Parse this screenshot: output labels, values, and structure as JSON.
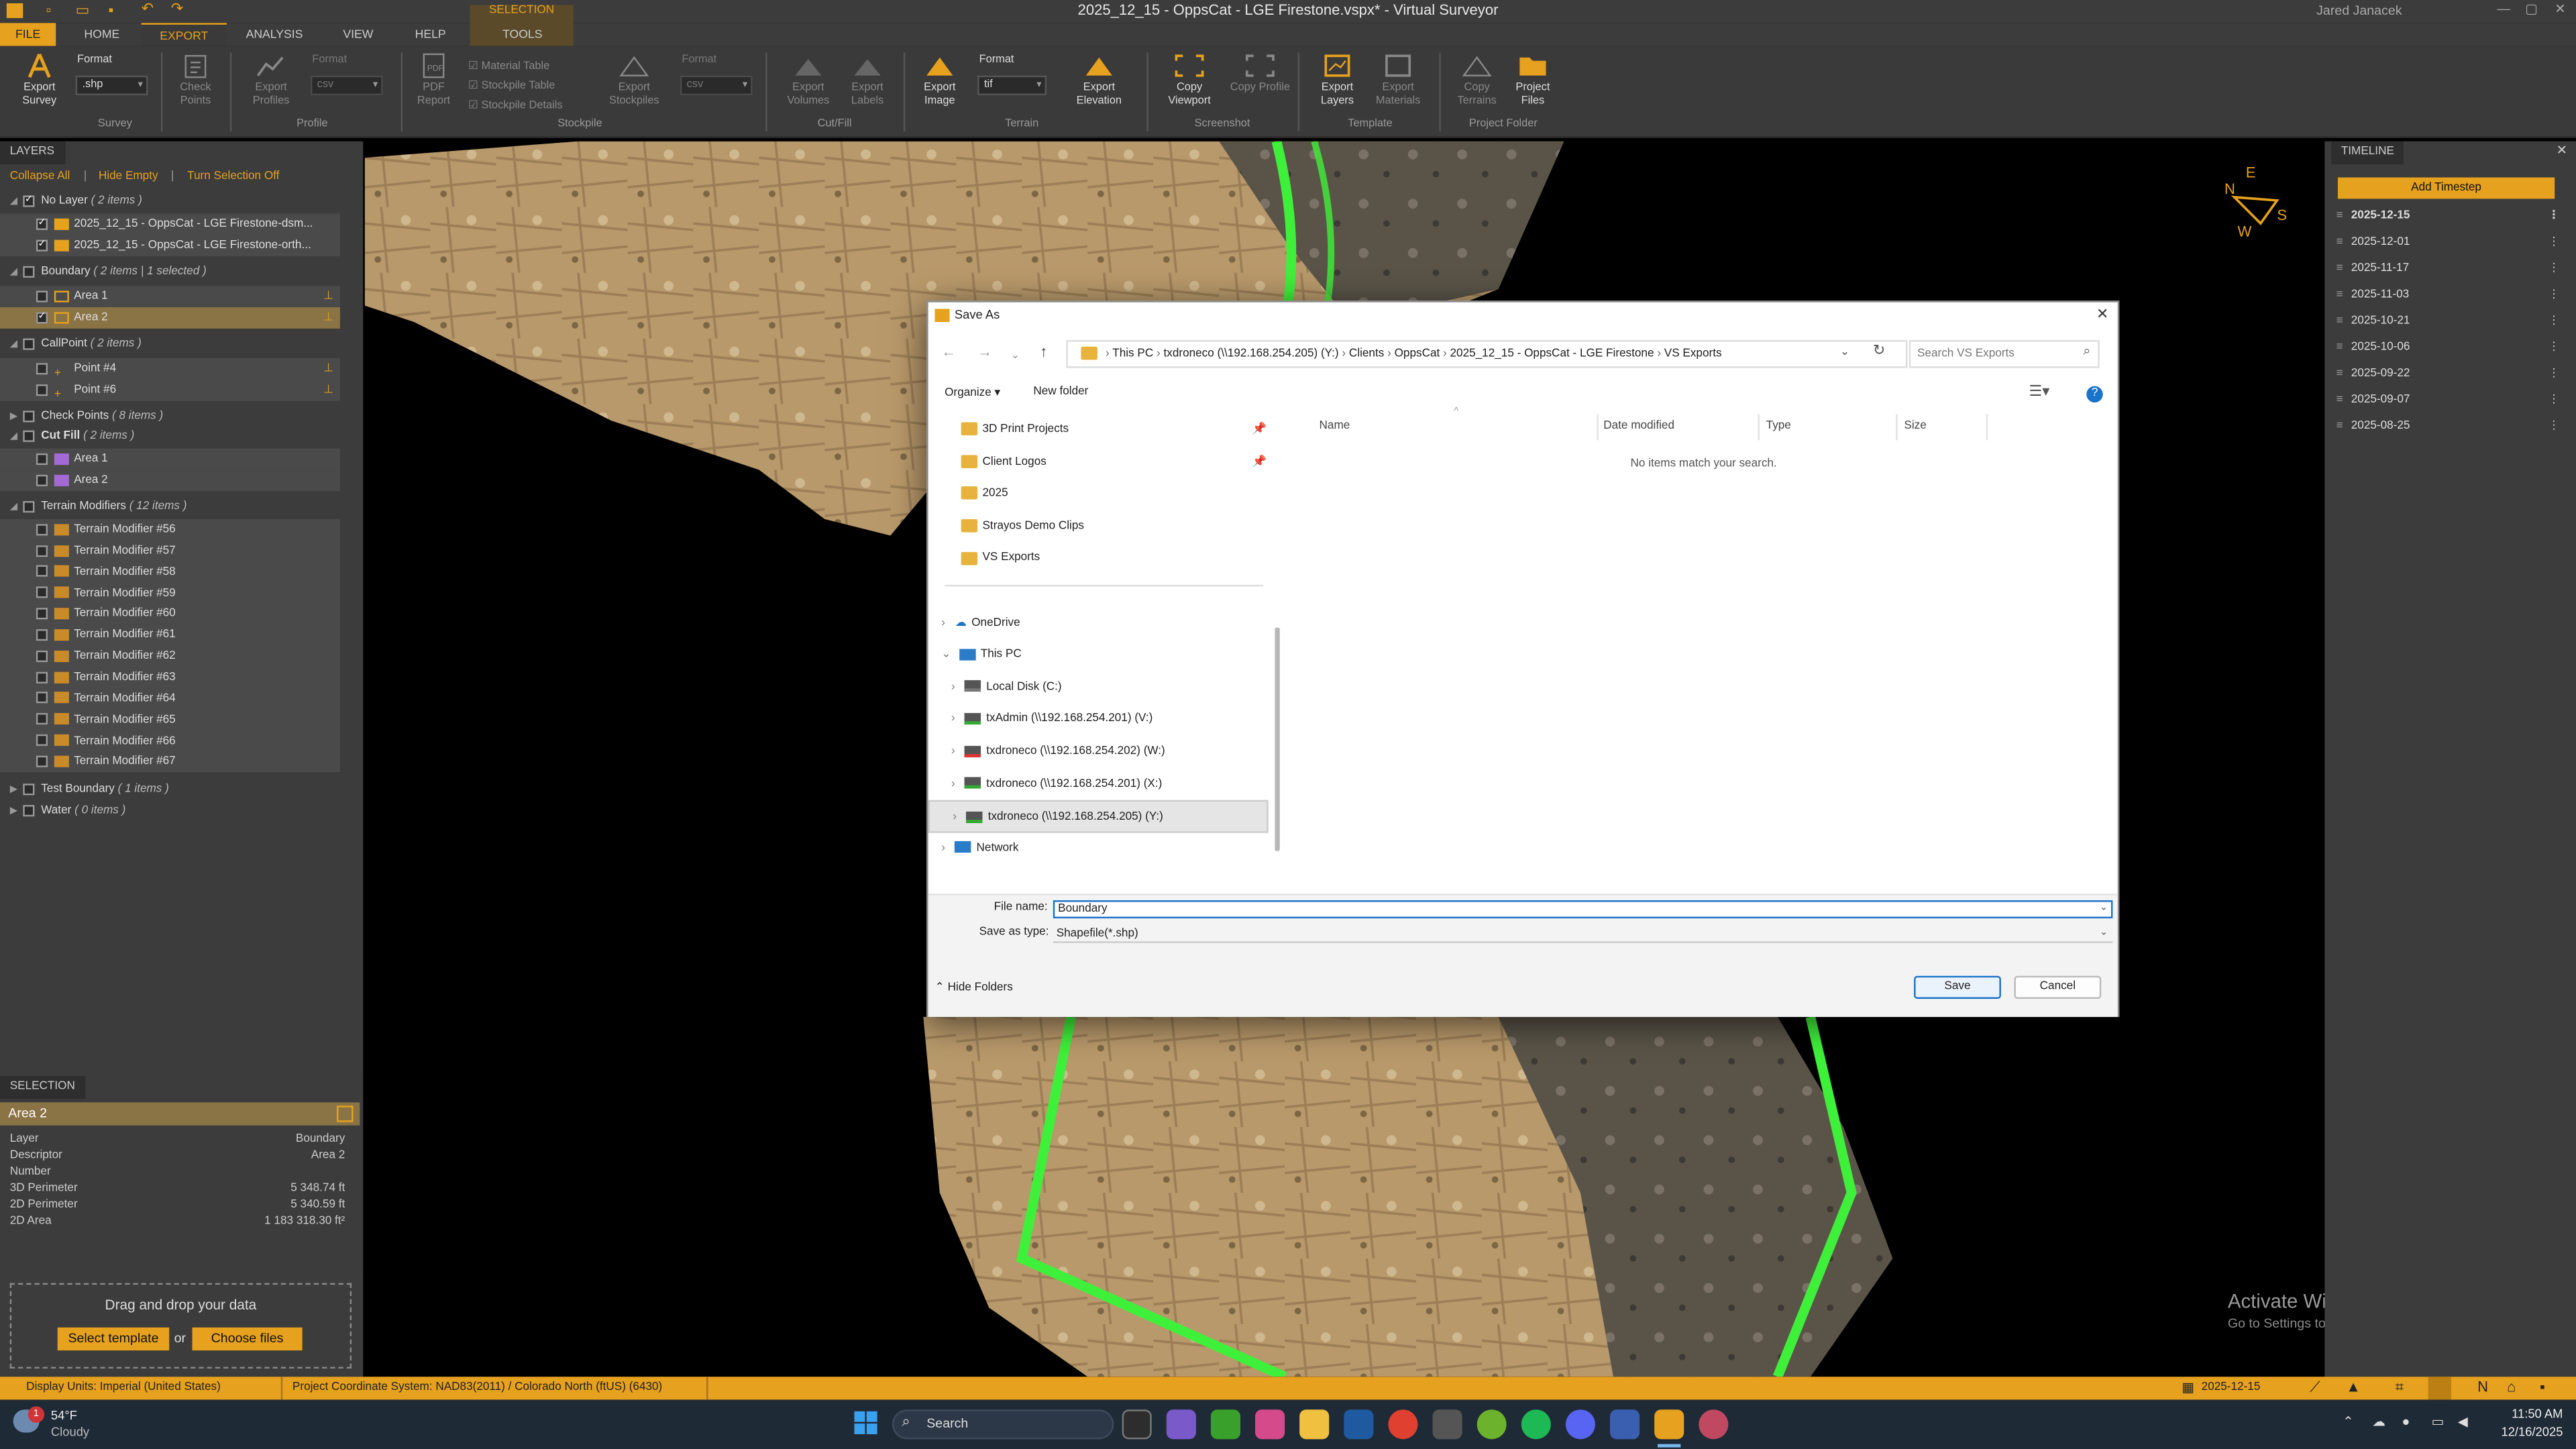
{
  "app": {
    "title": "2025_12_15 - OppsCat - LGE Firestone.vspx* - Virtual Surveyor",
    "user": "Jared Janacek",
    "selection_context": "SELECTION",
    "tabs": [
      "FILE",
      "HOME",
      "EXPORT",
      "ANALYSIS",
      "VIEW",
      "HELP",
      "TOOLS"
    ],
    "active_tab": "EXPORT",
    "accent_color": "#e6a11e"
  },
  "ribbon": {
    "survey": {
      "export_survey": "Export Survey",
      "format_label": "Format",
      "format_value": ".shp",
      "group": "Survey"
    },
    "check_points": "Check Points",
    "profile": {
      "export_profiles": "Export Profiles",
      "format_label": "Format",
      "format_value": "csv",
      "group": "Profile"
    },
    "stockpile": {
      "pdf_report": "PDF Report",
      "material_table": "Material Table",
      "stockpile_table": "Stockpile Table",
      "stockpile_details": "Stockpile Details",
      "export_stockpiles": "Export Stockpiles",
      "format_label": "Format",
      "format_value": "csv",
      "group": "Stockpile"
    },
    "cutfill": {
      "export_volumes": "Export Volumes",
      "export_labels": "Export Labels",
      "group": "Cut/Fill"
    },
    "terrain": {
      "export_image": "Export Image",
      "format_label": "Format",
      "format_value": "tif",
      "export_elevation": "Export Elevation",
      "group": "Terrain"
    },
    "screenshot": {
      "copy_viewport": "Copy Viewport",
      "copy_profile": "Copy Profile",
      "group": "Screenshot"
    },
    "template": {
      "export_layers": "Export Layers",
      "export_materials": "Export Materials",
      "group": "Template"
    },
    "project_folder": {
      "copy_terrains": "Copy Terrains",
      "project_files": "Project Files",
      "group": "Project Folder"
    }
  },
  "layers": {
    "header": "LAYERS",
    "actions": [
      "Collapse All",
      "Hide Empty",
      "Turn Selection Off"
    ],
    "groups": [
      {
        "name": "No Layer",
        "count": "( 2 items )",
        "items": [
          "2025_12_15 - OppsCat - LGE Firestone-dsm...",
          "2025_12_15 - OppsCat - LGE Firestone-orth..."
        ]
      },
      {
        "name": "Boundary",
        "count": "( 2 items | 1 selected )",
        "items": [
          "Area 1",
          "Area 2"
        ]
      },
      {
        "name": "CallPoint",
        "count": "( 2 items )",
        "items": [
          "Point #4",
          "Point #6"
        ]
      },
      {
        "name": "Check Points",
        "count": "( 8 items )",
        "items": []
      },
      {
        "name": "Cut Fill",
        "count": "( 2 items )",
        "items": [
          "Area 1",
          "Area 2"
        ]
      },
      {
        "name": "Terrain Modifiers",
        "count": "( 12 items )",
        "items": [
          "Terrain Modifier #56",
          "Terrain Modifier #57",
          "Terrain Modifier #58",
          "Terrain Modifier #59",
          "Terrain Modifier #60",
          "Terrain Modifier #61",
          "Terrain Modifier #62",
          "Terrain Modifier #63",
          "Terrain Modifier #64",
          "Terrain Modifier #65",
          "Terrain Modifier #66",
          "Terrain Modifier #67"
        ]
      },
      {
        "name": "Test Boundary",
        "count": "( 1 items )",
        "items": []
      },
      {
        "name": "Water",
        "count": "( 0 items )",
        "items": []
      }
    ]
  },
  "selection": {
    "header": "SELECTION",
    "name": "Area 2",
    "rows": [
      {
        "label": "Layer",
        "value": "Boundary"
      },
      {
        "label": "Descriptor",
        "value": "Area 2"
      },
      {
        "label": "Number",
        "value": ""
      },
      {
        "label": "3D Perimeter",
        "value": "5 348.74 ft"
      },
      {
        "label": "2D Perimeter",
        "value": "5 340.59 ft"
      },
      {
        "label": "2D Area",
        "value": "1 183 318.30 ft²"
      }
    ],
    "drop_text": "Drag and drop your data",
    "select_template": "Select template",
    "or": "or",
    "choose_files": "Choose files"
  },
  "timeline": {
    "header": "TIMELINE",
    "add_button": "Add Timestep",
    "dates": [
      "2025-12-15",
      "2025-12-01",
      "2025-11-17",
      "2025-11-03",
      "2025-10-21",
      "2025-10-06",
      "2025-09-22",
      "2025-09-07",
      "2025-08-25"
    ],
    "active": "2025-12-15"
  },
  "compass": {
    "n": "N",
    "e": "E",
    "s": "S",
    "w": "W"
  },
  "watermark": {
    "line1": "Activate Windows",
    "line2": "Go to Settings to activate Windows."
  },
  "statusbar": {
    "display_units": "Display Units:  Imperial (United States)",
    "coord_system": "Project Coordinate System:  NAD83(2011) / Colorado North (ftUS) (6430)",
    "date": "2025-12-15"
  },
  "taskbar": {
    "weather_temp": "54°F",
    "weather_cond": "Cloudy",
    "weather_badge": "1",
    "search": "Search",
    "time": "11:50 AM",
    "date": "12/16/2025"
  },
  "dialog": {
    "title": "Save As",
    "breadcrumb": [
      "This PC",
      "txdroneco (\\\\192.168.254.205) (Y:)",
      "Clients",
      "OppsCat",
      "2025_12_15 - OppsCat - LGE Firestone",
      "VS Exports"
    ],
    "search_placeholder": "Search VS Exports",
    "organize": "Organize",
    "new_folder": "New folder",
    "nav_quick": [
      "3D Print Projects",
      "Client Logos",
      "2025",
      "Strayos Demo Clips",
      "VS Exports"
    ],
    "onedrive": "OneDrive",
    "this_pc": "This PC",
    "drives": [
      "Local Disk (C:)",
      "txAdmin (\\\\192.168.254.201) (V:)",
      "txdroneco (\\\\192.168.254.202) (W:)",
      "txdroneco (\\\\192.168.254.201) (X:)",
      "txdroneco (\\\\192.168.254.205) (Y:)"
    ],
    "network": "Network",
    "columns": [
      "Name",
      "Date modified",
      "Type",
      "Size"
    ],
    "empty_message": "No items match your search.",
    "file_name_label": "File name:",
    "file_name_value": "Boundary",
    "save_type_label": "Save as type:",
    "save_type_value": "Shapefile(*.shp)",
    "hide_folders": "Hide Folders",
    "save": "Save",
    "cancel": "Cancel"
  }
}
